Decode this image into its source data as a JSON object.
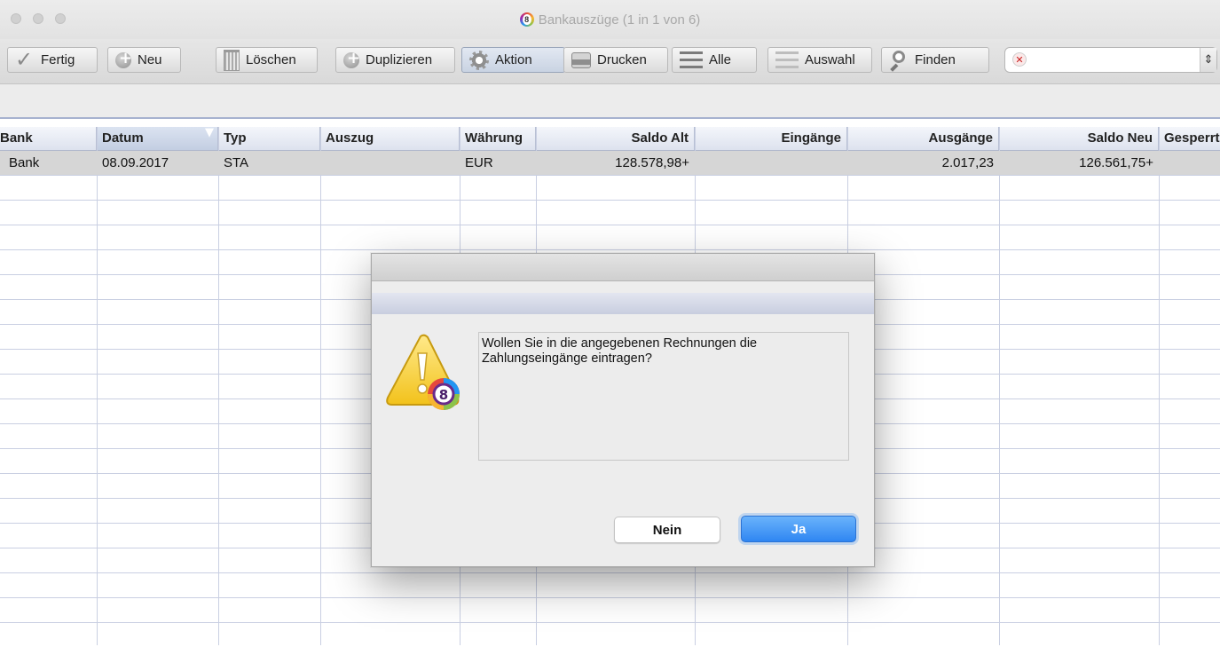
{
  "window": {
    "title": "Bankauszüge (1 in 1 von 6)"
  },
  "toolbar": {
    "fertig": "Fertig",
    "neu": "Neu",
    "loeschen": "Löschen",
    "duplizieren": "Duplizieren",
    "aktion": "Aktion",
    "drucken": "Drucken",
    "alle": "Alle",
    "auswahl": "Auswahl",
    "finden": "Finden",
    "search_value": ""
  },
  "table": {
    "columns": [
      "Bank",
      "Datum",
      "Typ",
      "Auszug",
      "Währung",
      "Saldo Alt",
      "Eingänge",
      "Ausgänge",
      "Saldo Neu",
      "Gesperrt"
    ],
    "rows": [
      [
        "Bank",
        "08.09.2017",
        "STA",
        "",
        "EUR",
        "128.578,98+",
        "",
        "2.017,23",
        "126.561,75+",
        ""
      ]
    ]
  },
  "dialog": {
    "message": "Wollen Sie in die angegebenen Rechnungen die Zahlungseingänge eintragen?",
    "no_label": "Nein",
    "yes_label": "Ja"
  }
}
